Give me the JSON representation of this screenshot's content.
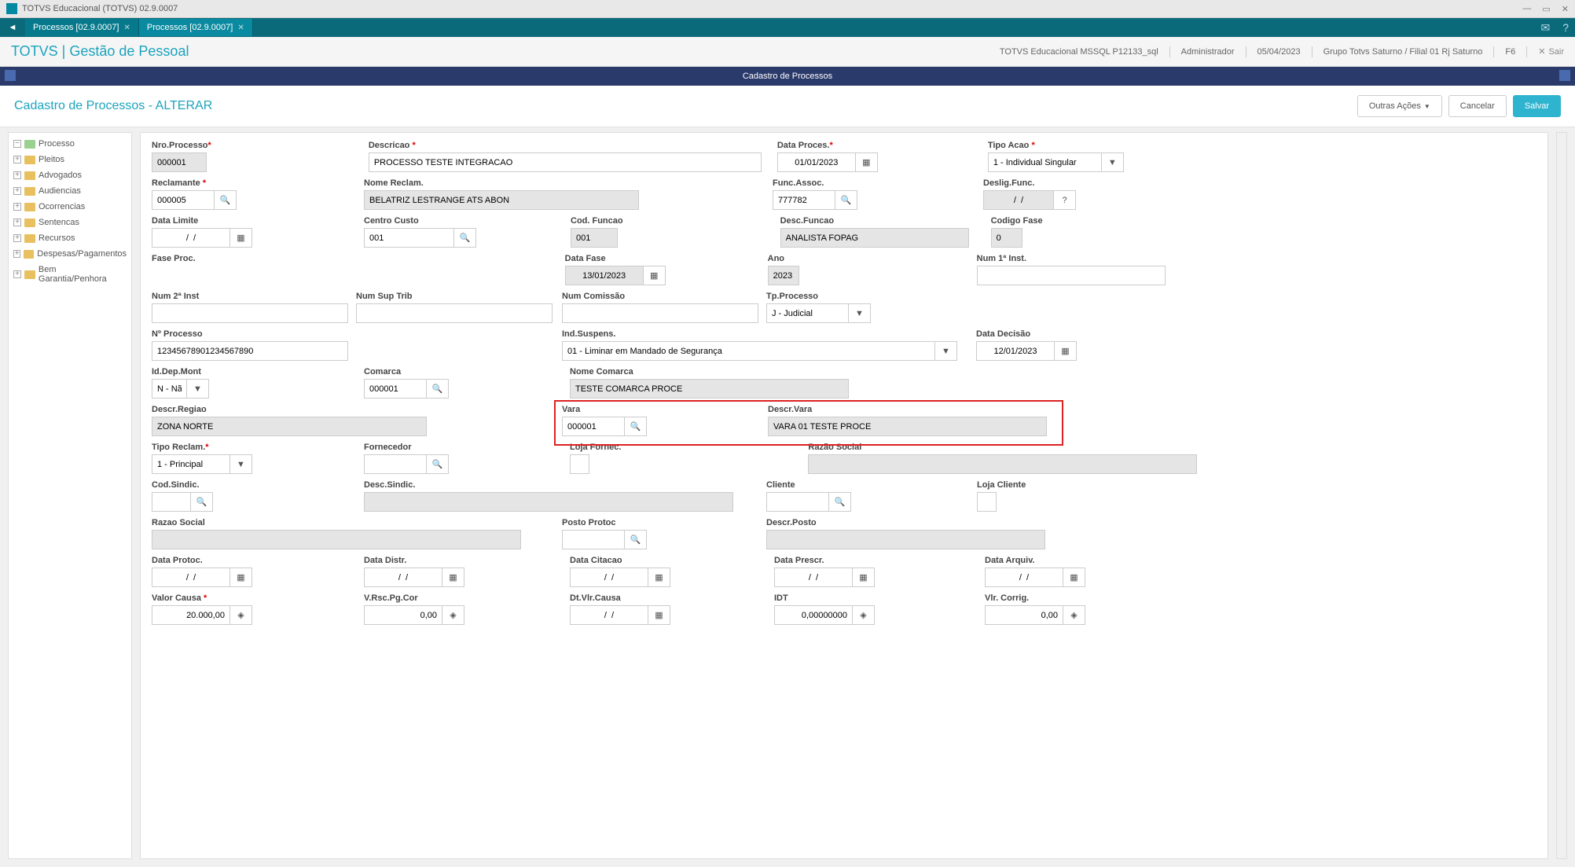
{
  "window": {
    "title": "TOTVS Educacional (TOTVS) 02.9.0007"
  },
  "tabs": [
    {
      "label": "Processos [02.9.0007]"
    },
    {
      "label": "Processos [02.9.0007]"
    }
  ],
  "header": {
    "app_title": "TOTVS | Gestão de Pessoal",
    "db": "TOTVS Educacional MSSQL P12133_sql",
    "user": "Administrador",
    "date": "05/04/2023",
    "group": "Grupo Totvs Saturno / Filial 01 Rj Saturno",
    "fkey": "F6",
    "sair": "Sair"
  },
  "modal": {
    "title": "Cadastro de Processos"
  },
  "page": {
    "title": "Cadastro de Processos - ALTERAR",
    "outras_acoes": "Outras Ações",
    "cancelar": "Cancelar",
    "salvar": "Salvar"
  },
  "tree": [
    "Processo",
    "Pleitos",
    "Advogados",
    "Audiencias",
    "Ocorrencias",
    "Sentencas",
    "Recursos",
    "Despesas/Pagamentos",
    "Bem Garantia/Penhora"
  ],
  "form": {
    "nro_processo": {
      "label": "Nro.Processo",
      "value": "000001"
    },
    "descricao": {
      "label": "Descricao",
      "value": "PROCESSO TESTE INTEGRACAO"
    },
    "data_proces": {
      "label": "Data Proces.",
      "value": "01/01/2023"
    },
    "tipo_acao": {
      "label": "Tipo Acao",
      "value": "1 - Individual Singular"
    },
    "reclamante": {
      "label": "Reclamante",
      "value": "000005"
    },
    "nome_reclam": {
      "label": "Nome Reclam.",
      "value": "BELATRIZ LESTRANGE ATS ABON"
    },
    "func_assoc": {
      "label": "Func.Assoc.",
      "value": "777782"
    },
    "deslig_func": {
      "label": "Deslig.Func.",
      "value": "/  /"
    },
    "data_limite": {
      "label": "Data Limite",
      "value": "/  /"
    },
    "centro_custo": {
      "label": "Centro Custo",
      "value": "001"
    },
    "cod_funcao": {
      "label": "Cod. Funcao",
      "value": "001"
    },
    "desc_funcao": {
      "label": "Desc.Funcao",
      "value": "ANALISTA FOPAG"
    },
    "codigo_fase": {
      "label": "Codigo Fase",
      "value": "0"
    },
    "fase_proc": {
      "label": "Fase Proc."
    },
    "data_fase": {
      "label": "Data Fase",
      "value": "13/01/2023"
    },
    "ano": {
      "label": "Ano",
      "value": "2023"
    },
    "num_1a": {
      "label": "Num 1ª Inst."
    },
    "num_2a": {
      "label": "Num 2ª Inst"
    },
    "num_sup": {
      "label": "Num Sup Trib"
    },
    "num_comissao": {
      "label": "Num Comissão"
    },
    "tp_processo": {
      "label": "Tp.Processo",
      "value": "J - Judicial"
    },
    "n_processo": {
      "label": "Nº Processo",
      "value": "12345678901234567890"
    },
    "ind_suspens": {
      "label": "Ind.Suspens.",
      "value": "01 - Liminar em Mandado de Segurança"
    },
    "data_decisao": {
      "label": "Data Decisão",
      "value": "12/01/2023"
    },
    "id_dep_mont": {
      "label": "Id.Dep.Mont",
      "value": "N - Não"
    },
    "comarca": {
      "label": "Comarca",
      "value": "000001"
    },
    "nome_comarca": {
      "label": "Nome Comarca",
      "value": "TESTE COMARCA PROCE"
    },
    "descr_regiao": {
      "label": "Descr.Regiao",
      "value": "ZONA NORTE"
    },
    "vara": {
      "label": "Vara",
      "value": "000001"
    },
    "descr_vara": {
      "label": "Descr.Vara",
      "value": "VARA 01 TESTE PROCE"
    },
    "tipo_reclam": {
      "label": "Tipo Reclam.",
      "value": "1 - Principal"
    },
    "fornecedor": {
      "label": "Fornecedor"
    },
    "loja_fornec": {
      "label": "Loja Fornec."
    },
    "razao_social": {
      "label": "Razão Social"
    },
    "cod_sindic": {
      "label": "Cod.Sindic."
    },
    "desc_sindic": {
      "label": "Desc.Sindic."
    },
    "cliente": {
      "label": "Cliente"
    },
    "loja_cliente": {
      "label": "Loja Cliente"
    },
    "razao_social2": {
      "label": "Razao Social"
    },
    "posto_protoc": {
      "label": "Posto Protoc"
    },
    "descr_posto": {
      "label": "Descr.Posto"
    },
    "data_protoc": {
      "label": "Data Protoc.",
      "value": "/  /"
    },
    "data_distr": {
      "label": "Data Distr.",
      "value": "/  /"
    },
    "data_citacao": {
      "label": "Data Citacao",
      "value": "/  /"
    },
    "data_prescr": {
      "label": "Data Prescr.",
      "value": "/  /"
    },
    "data_arquiv": {
      "label": "Data Arquiv.",
      "value": "/  /"
    },
    "valor_causa": {
      "label": "Valor Causa",
      "value": "20.000,00"
    },
    "vrsc": {
      "label": "V.Rsc.Pg.Cor",
      "value": "0,00"
    },
    "dtvlr": {
      "label": "Dt.Vlr.Causa",
      "value": "/  /"
    },
    "idt": {
      "label": "IDT",
      "value": "0,00000000"
    },
    "vlrcorrig": {
      "label": "Vlr. Corrig.",
      "value": "0,00"
    }
  }
}
